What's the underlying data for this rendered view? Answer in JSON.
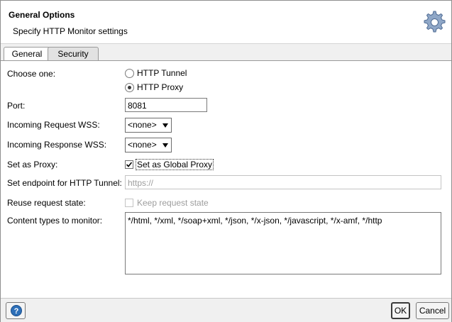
{
  "header": {
    "title": "General Options",
    "subtitle": "Specify HTTP Monitor settings",
    "icon": "gear-icon"
  },
  "tabs": [
    {
      "label": "General",
      "active": true
    },
    {
      "label": "Security",
      "active": false
    }
  ],
  "form": {
    "choose_one": {
      "label": "Choose one:",
      "options": [
        "HTTP Tunnel",
        "HTTP Proxy"
      ],
      "selected": "HTTP Proxy"
    },
    "port": {
      "label": "Port:",
      "value": "8081"
    },
    "incoming_request_wss": {
      "label": "Incoming Request WSS:",
      "value": "<none>"
    },
    "incoming_response_wss": {
      "label": "Incoming Response WSS:",
      "value": "<none>"
    },
    "set_as_proxy": {
      "label": "Set as Proxy:",
      "checkbox_label": "Set as Global Proxy",
      "checked": true
    },
    "endpoint": {
      "label": "Set endpoint for HTTP Tunnel:",
      "placeholder": "https://"
    },
    "reuse_state": {
      "label": "Reuse request state:",
      "checkbox_label": "Keep request state",
      "checked": false
    },
    "content_types": {
      "label": "Content types to monitor:",
      "value": "*/html, */xml, */soap+xml, */json, */x-json, */javascript, */x-amf, */http"
    }
  },
  "footer": {
    "help_icon": "help-icon",
    "ok_label": "OK",
    "cancel_label": "Cancel"
  }
}
